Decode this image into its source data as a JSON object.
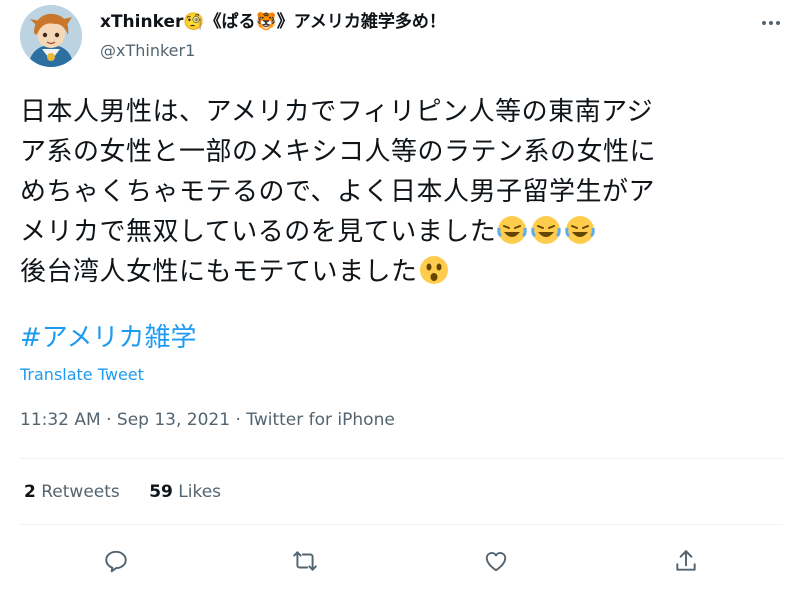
{
  "user": {
    "display_name": "xThinker🧐《ぱる🐯》アメリカ雑学多め！",
    "handle": "@xThinker1"
  },
  "tweet": {
    "lines": [
      "日本人男性は、アメリカでフィリピン人等の東南アジ",
      "ア系の女性と一部のメキシコ人等のラテン系の女性に",
      "めちゃくちゃモテるので、よく日本人男子留学生がア",
      "メリカで無双しているのを見ていました",
      "後台湾人女性にもモテていました"
    ],
    "hashtag": "#アメリカ雑学",
    "translate_label": "Translate Tweet",
    "meta": "11:32 AM · Sep 13, 2021 · Twitter for iPhone"
  },
  "stats": {
    "retweets_count": "2",
    "retweets_label": "Retweets",
    "likes_count": "59",
    "likes_label": "Likes"
  },
  "icons": {
    "reply": "reply-icon",
    "retweet": "retweet-icon",
    "like": "heart-icon",
    "share": "share-icon",
    "more": "more-icon"
  },
  "colors": {
    "link": "#1d9bf0",
    "secondary": "#536471",
    "text": "#0f1419",
    "divider": "#eff3f4"
  }
}
